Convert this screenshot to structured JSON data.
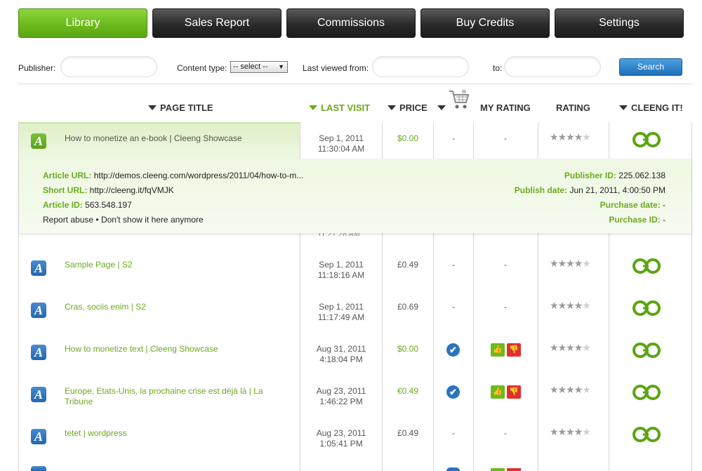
{
  "tabs": [
    {
      "label": "Library",
      "active": true
    },
    {
      "label": "Sales Report",
      "active": false
    },
    {
      "label": "Commissions",
      "active": false
    },
    {
      "label": "Buy Credits",
      "active": false
    },
    {
      "label": "Settings",
      "active": false
    }
  ],
  "filters": {
    "publisher_label": "Publisher:",
    "publisher_value": "",
    "content_type_label": "Content type:",
    "content_type_value": "-- select --",
    "last_viewed_label": "Last viewed from:",
    "from_value": "",
    "to_label": "to:",
    "to_value": "",
    "search_label": "Search"
  },
  "columns": {
    "page_title": "PAGE TITLE",
    "last_visit": "LAST VISIT",
    "price": "PRICE",
    "purchased_icon": "shopping-cart-icon",
    "my_rating": "MY RATING",
    "rating": "RATING",
    "cleeng_it": "CLEENG IT!"
  },
  "expanded": {
    "title": "How to monetize an e-book | Cleeng Showcase",
    "date": "Sep 1, 2011",
    "time": "11:30:04 AM",
    "price": "$0.00",
    "purchased": "-",
    "my_rating": "-",
    "rating": 4,
    "article_url_label": "Article URL:",
    "article_url": "http://demos.cleeng.com/wordpress/2011/04/how-to-m...",
    "short_url_label": "Short URL:",
    "short_url": "http://cleeng.it/fqVMJK",
    "article_id_label": "Article ID:",
    "article_id": "563.548.197",
    "report_abuse": "Report abuse",
    "bullet": "•",
    "dont_show": "Don't show it here anymore",
    "publisher_id_label": "Publisher ID:",
    "publisher_id": "225.062.138",
    "publish_date_label": "Publish date:",
    "publish_date": "Jun 21, 2011, 4:00:50 PM",
    "purchase_date_label": "Purchase date:",
    "purchase_date": "-",
    "purchase_id_label": "Purchase ID:",
    "purchase_id": "-",
    "peek_time": "11:21:28 AM"
  },
  "rows": [
    {
      "title": "Sample Page | S2",
      "date": "Sep 1, 2011",
      "time": "11:18:16 AM",
      "price": "£0.49",
      "purchased": "-",
      "my_rating": "-",
      "rating": 4
    },
    {
      "title": "Cras, sociis enim | S2",
      "date": "Sep 1, 2011",
      "time": "11:17:49 AM",
      "price": "£0.69",
      "purchased": "-",
      "my_rating": "-",
      "rating": 4
    },
    {
      "title": "How to monetize text | Cleeng Showcase",
      "date": "Aug 31, 2011",
      "time": "4:18:04 PM",
      "price": "$0.00",
      "purchased": "check",
      "my_rating": "thumbs",
      "rating": 4
    },
    {
      "title_line1": "Europe, Etats-Unis, la prochaine crise est déjà là | La",
      "title_line2": "Tribune",
      "date": "Aug 23, 2011",
      "time": "1:46:22 PM",
      "price": "€0.49",
      "purchased": "check",
      "my_rating": "thumbs",
      "rating": 4
    },
    {
      "title": "tetet | wordpress",
      "date": "Aug 23, 2011",
      "time": "1:05:41 PM",
      "price": "£0.49",
      "purchased": "-",
      "my_rating": "-",
      "rating": 4
    }
  ],
  "icons": {
    "article": "A",
    "check": "✔",
    "thumb_up": "👍",
    "thumb_down": "👎",
    "star": "★"
  }
}
